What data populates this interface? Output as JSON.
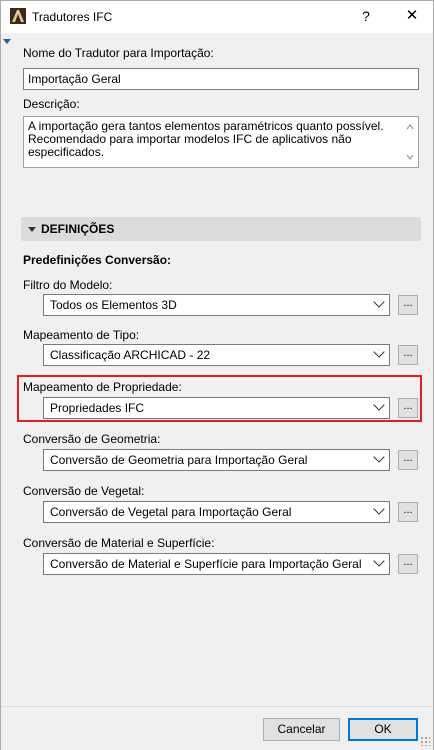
{
  "window": {
    "title": "Tradutores IFC",
    "help_label": "?",
    "close_label": "✕"
  },
  "translator_name": {
    "label": "Nome do Tradutor para Importação:",
    "value": "Importação Geral"
  },
  "description": {
    "label": "Descrição:",
    "value": "A importação gera tantos elementos paramétricos quanto possível. Recomendado para importar modelos IFC de aplicativos não especificados."
  },
  "settings": {
    "section_title": "DEFINIÇÕES",
    "subtitle": "Predefinições Conversão:",
    "fields": [
      {
        "label": "Filtro do Modelo:",
        "value": "Todos os Elementos 3D"
      },
      {
        "label": "Mapeamento de Tipo:",
        "value": "Classificação ARCHICAD - 22"
      },
      {
        "label": "Mapeamento de Propriedade:",
        "value": "Propriedades IFC"
      },
      {
        "label": "Conversão de Geometria:",
        "value": "Conversão de Geometria para Importação Geral"
      },
      {
        "label": "Conversão de Vegetal:",
        "value": "Conversão de Vegetal para Importação Geral"
      },
      {
        "label": "Conversão de Material e Superfície:",
        "value": "Conversão de Material e Superfície para Importação Geral"
      }
    ],
    "dots_label": "..."
  },
  "footer": {
    "cancel_label": "Cancelar",
    "ok_label": "OK"
  },
  "icons": {
    "app": "archicad-app-icon",
    "collapse": "triangle-down-icon"
  },
  "colors": {
    "highlight": "#e02020",
    "accent": "#0078d7"
  }
}
